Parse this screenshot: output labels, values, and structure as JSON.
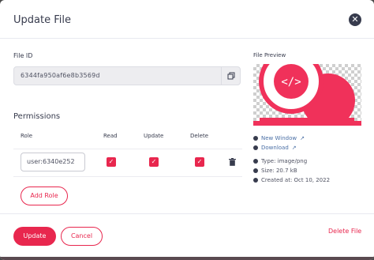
{
  "modal": {
    "title": "Update File",
    "close_icon": "close-icon"
  },
  "file_id": {
    "label": "File ID",
    "value": "6344fa950af6e8b3569d",
    "copy_icon": "copy-icon"
  },
  "permissions": {
    "title": "Permissions",
    "headers": {
      "role": "Role",
      "read": "Read",
      "update": "Update",
      "delete": "Delete"
    },
    "rows": [
      {
        "role": "user:6340e252",
        "read": true,
        "update": true,
        "delete": true
      }
    ],
    "add_role_label": "Add Role"
  },
  "preview": {
    "label": "File Preview",
    "new_window_label": "New Window",
    "download_label": "Download",
    "type": "Type: image/png",
    "size": "Size: 20.7 kB",
    "created": "Created at: Oct 10, 2022"
  },
  "footer": {
    "update_label": "Update",
    "cancel_label": "Cancel",
    "delete_label": "Delete File"
  },
  "colors": {
    "accent": "#e8274e",
    "text": "#373b4d",
    "link": "#4a6fa5"
  }
}
